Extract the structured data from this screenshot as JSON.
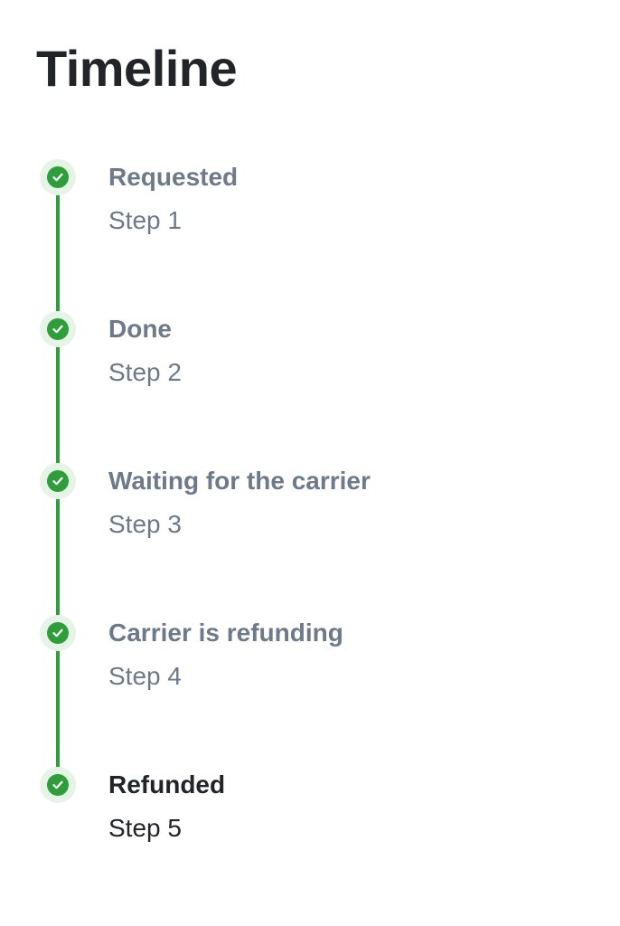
{
  "page": {
    "title": "Timeline"
  },
  "timeline": {
    "accent_color": "#2e9e3a",
    "steps": [
      {
        "title": "Requested",
        "subtitle": "Step 1",
        "status": "complete",
        "icon": "check-icon"
      },
      {
        "title": "Done",
        "subtitle": "Step 2",
        "status": "complete",
        "icon": "check-icon"
      },
      {
        "title": "Waiting for the carrier",
        "subtitle": "Step 3",
        "status": "complete",
        "icon": "check-icon"
      },
      {
        "title": "Carrier is refunding",
        "subtitle": "Step 4",
        "status": "complete",
        "icon": "check-icon"
      },
      {
        "title": "Refunded",
        "subtitle": "Step 5",
        "status": "current",
        "icon": "check-icon"
      }
    ]
  }
}
